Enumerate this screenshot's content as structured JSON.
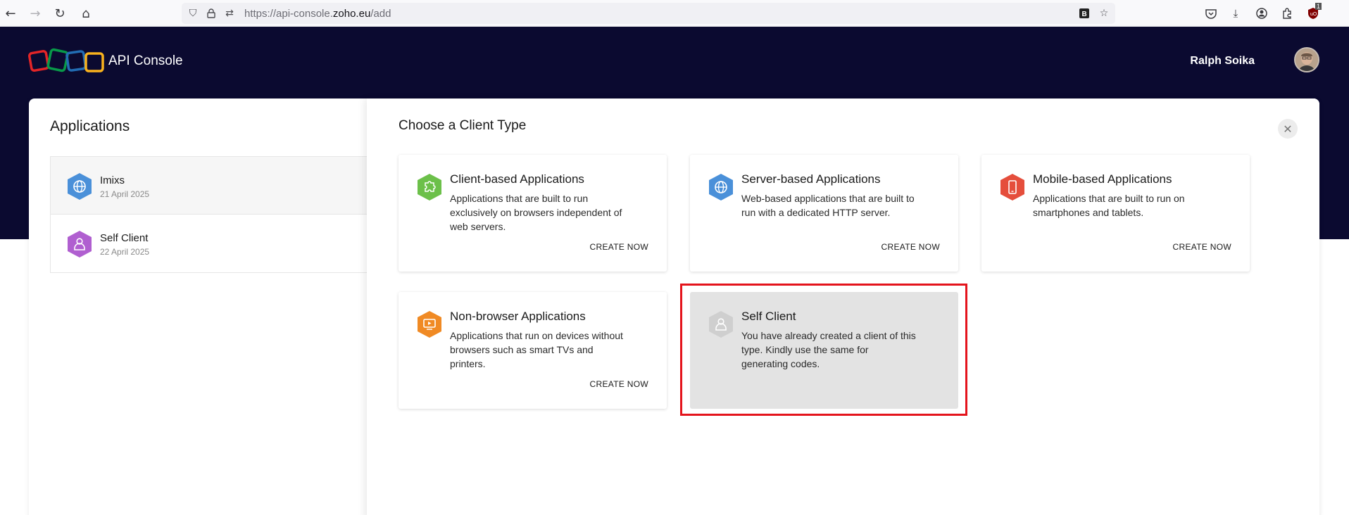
{
  "browser": {
    "url_prefix": "https://api-console.",
    "url_domain": "zoho.eu",
    "url_path": "/add",
    "badge_count": "1"
  },
  "header": {
    "brand": "API Console",
    "user_name": "Ralph Soika"
  },
  "applications": {
    "title": "Applications",
    "items": [
      {
        "name": "Imixs",
        "date": "21 April 2025",
        "color": "#4a90d9",
        "icon": "globe-icon"
      },
      {
        "name": "Self Client",
        "date": "22 April 2025",
        "color": "#b05fd0",
        "icon": "person-icon"
      }
    ]
  },
  "drawer": {
    "title": "Choose a Client Type",
    "cards": [
      {
        "title": "Client-based Applications",
        "desc": "Applications that are built to run exclusively on browsers independent of web servers.",
        "action": "CREATE NOW",
        "color": "#6cc04a",
        "icon": "puzzle-icon"
      },
      {
        "title": "Server-based Applications",
        "desc": "Web-based applications that are built to run with a dedicated HTTP server.",
        "action": "CREATE NOW",
        "color": "#4a90d9",
        "icon": "globe-icon"
      },
      {
        "title": "Mobile-based Applications",
        "desc": "Applications that are built to run on smartphones and tablets.",
        "action": "CREATE NOW",
        "color": "#e54e3c",
        "icon": "phone-icon"
      },
      {
        "title": "Non-browser Applications",
        "desc": "Applications that run on devices without browsers such as smart TVs and printers.",
        "action": "CREATE NOW",
        "color": "#f08a24",
        "icon": "tv-icon"
      },
      {
        "title": "Self Client",
        "desc": "You have already created a client of this type. Kindly use the same for generating codes.",
        "action": "",
        "color": "#cfcfcf",
        "icon": "person-icon"
      }
    ]
  }
}
